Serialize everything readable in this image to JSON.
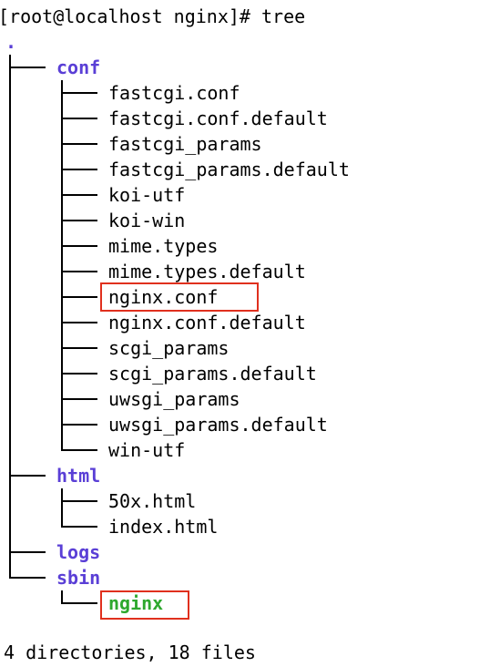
{
  "terminal": {
    "prompt": "[root@localhost nginx]# ",
    "command": "tree",
    "root": ".",
    "colors": {
      "directory": "#5a3fd6",
      "executable": "#2ea82e",
      "highlight_box": "#e0301e",
      "text": "#000000"
    },
    "tree": {
      "conf": {
        "name": "conf",
        "files": [
          "fastcgi.conf",
          "fastcgi.conf.default",
          "fastcgi_params",
          "fastcgi_params.default",
          "koi-utf",
          "koi-win",
          "mime.types",
          "mime.types.default",
          "nginx.conf",
          "nginx.conf.default",
          "scgi_params",
          "scgi_params.default",
          "uwsgi_params",
          "uwsgi_params.default",
          "win-utf"
        ]
      },
      "html": {
        "name": "html",
        "files": [
          "50x.html",
          "index.html"
        ]
      },
      "logs": {
        "name": "logs"
      },
      "sbin": {
        "name": "sbin",
        "files": [
          "nginx"
        ]
      }
    },
    "summary": "4 directories, 18 files"
  }
}
